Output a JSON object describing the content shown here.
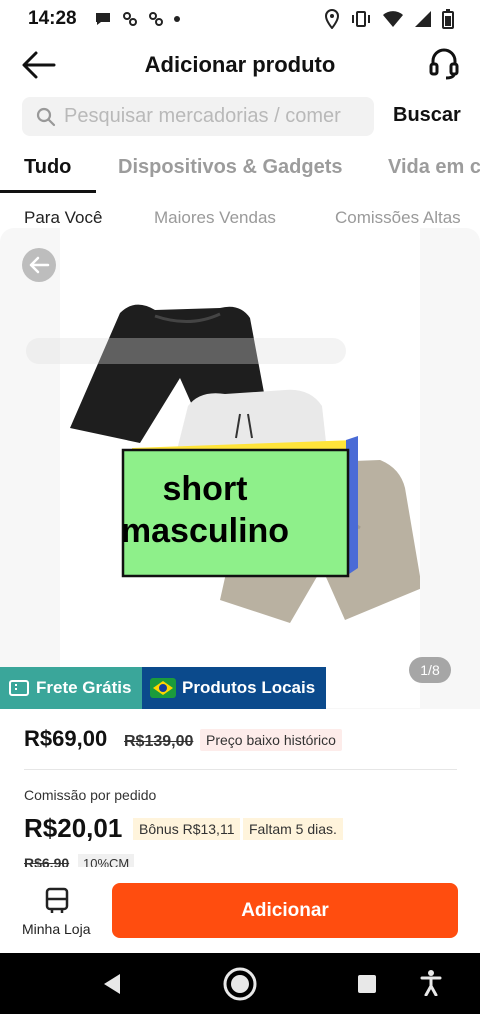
{
  "status_bar": {
    "time": "14:28"
  },
  "header": {
    "title": "Adicionar produto"
  },
  "search": {
    "placeholder": "Pesquisar mercadorias / comer",
    "button_label": "Buscar"
  },
  "category_tabs": [
    {
      "label": "Tudo"
    },
    {
      "label": "Dispositivos & Gadgets"
    },
    {
      "label": "Vida em c"
    }
  ],
  "sub_tabs": [
    {
      "label": "Para Você"
    },
    {
      "label": "Maiores Vendas"
    },
    {
      "label": "Comissões Altas"
    }
  ],
  "product": {
    "image_text_line1": "short",
    "image_text_line2": "masculino",
    "image_counter": "1/8",
    "badge_frete": "Frete Grátis",
    "badge_local": "Produtos Locais",
    "price": "R$69,00",
    "old_price": "R$139,00",
    "price_tag": "Preço baixo histórico",
    "commission_label": "Comissão por pedido",
    "commission_value": "R$20,01",
    "bonus": "Bônus R$13,11",
    "days_left": "Faltam 5 dias.",
    "old_commission": "R$6,90",
    "commission_rate": "10%CM"
  },
  "action_bar": {
    "store_label": "Minha Loja",
    "add_label": "Adicionar"
  },
  "colors": {
    "accent": "#ff4d0f",
    "frete": "#3aa69a",
    "local": "#0b4a8c",
    "sticker": "#8ef08a"
  }
}
